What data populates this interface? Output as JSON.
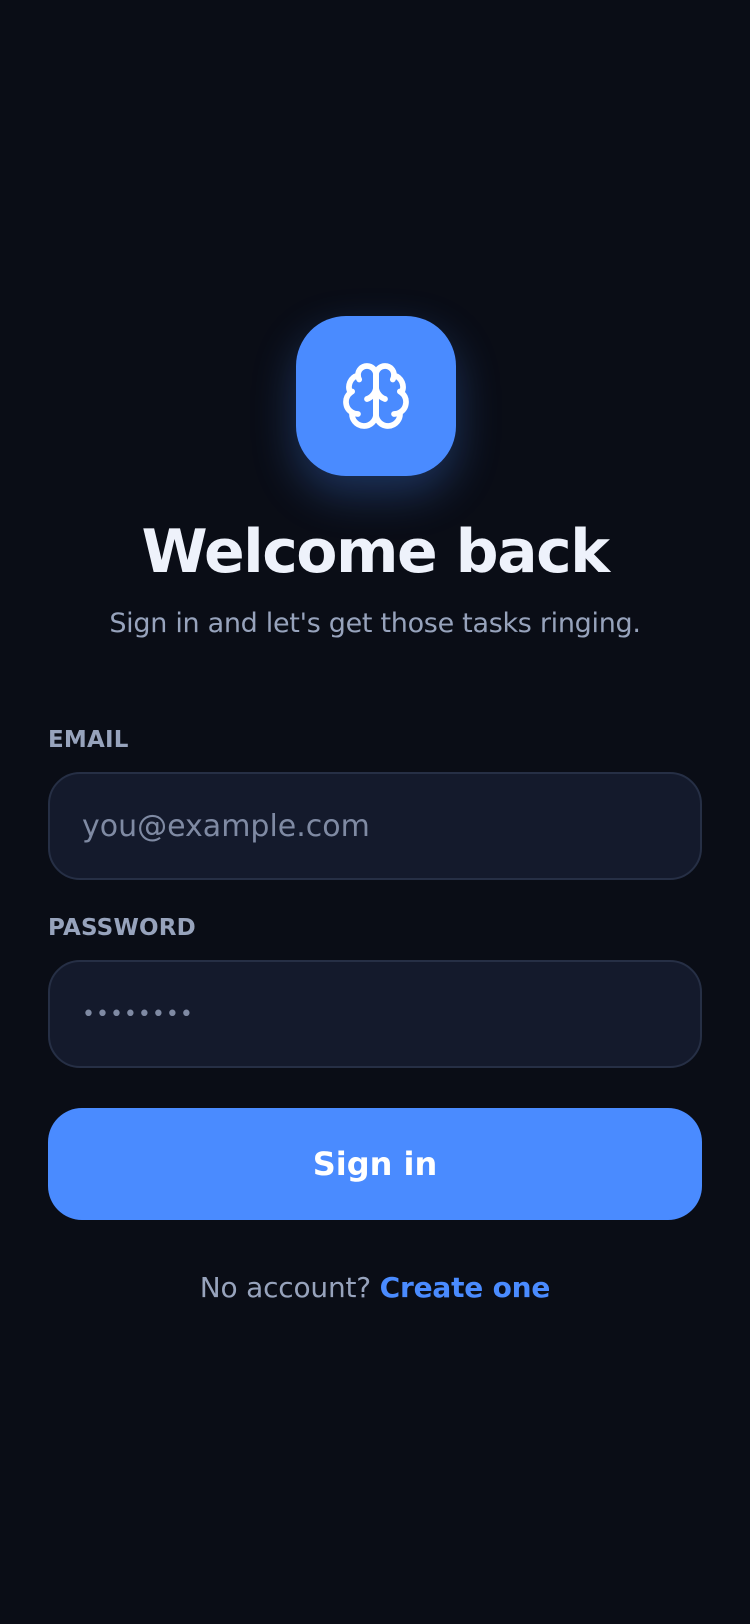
{
  "logo": {
    "icon": "brain-icon",
    "background": "#4a8bff"
  },
  "header": {
    "title": "Welcome back",
    "subtitle": "Sign in and let's get those tasks ringing."
  },
  "form": {
    "email": {
      "label": "EMAIL",
      "placeholder": "you@example.com",
      "value": ""
    },
    "password": {
      "label": "PASSWORD",
      "masked_value": "••••••••"
    },
    "submit_label": "Sign in"
  },
  "footer": {
    "prompt": "No account?",
    "link": "Create one"
  },
  "colors": {
    "background": "#0a0d16",
    "accent": "#4a8bff",
    "field_background": "#141a2c",
    "muted_text": "#97a3bc"
  }
}
